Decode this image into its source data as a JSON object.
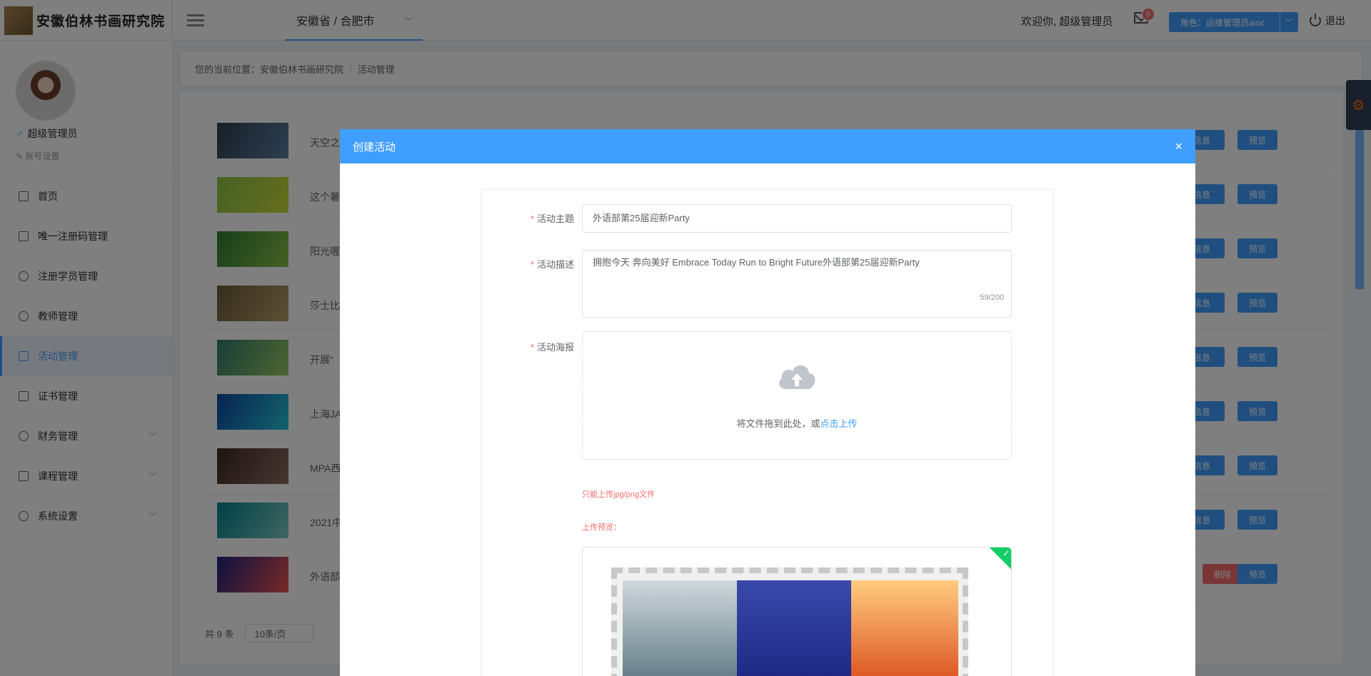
{
  "header": {
    "logo_text": "安徽伯林书画研究院",
    "region": "安徽省 / 合肥市",
    "welcome": "欢迎你, 超级管理员",
    "mail_count": "0",
    "role_label": "角色：运维管理员aioc",
    "logout": "退出"
  },
  "sidebar": {
    "user_name": "超级管理员",
    "account_settings": "账号设置",
    "items": [
      {
        "label": "首页"
      },
      {
        "label": "唯一注册码管理"
      },
      {
        "label": "注册学员管理"
      },
      {
        "label": "教师管理"
      },
      {
        "label": "活动管理"
      },
      {
        "label": "证书管理"
      },
      {
        "label": "财务管理"
      },
      {
        "label": "课程管理"
      },
      {
        "label": "系统设置"
      }
    ]
  },
  "breadcrumb": {
    "prefix": "您的当前位置：",
    "root": "安徽伯林书画研究院",
    "current": "活动管理"
  },
  "table": {
    "rows": [
      {
        "title": "天空之",
        "info": "名信息",
        "preview": "预览"
      },
      {
        "title": "这个暑",
        "info": "名信息",
        "preview": "预览"
      },
      {
        "title": "阳光喔",
        "info": "名信息",
        "preview": "预览"
      },
      {
        "title": "莎士比",
        "info": "名信息",
        "preview": "预览"
      },
      {
        "title": "开展“",
        "info": "名信息",
        "preview": "预览"
      },
      {
        "title": "上海JA",
        "info": "名信息",
        "preview": "预览"
      },
      {
        "title": "MPA西",
        "info": "名信息",
        "preview": "预览"
      },
      {
        "title": "2021中",
        "info": "名信息",
        "preview": "预览"
      },
      {
        "title": "外语部",
        "delete": "删除",
        "preview": "预览"
      }
    ],
    "total": "共 9 条",
    "page_size": "10条/页"
  },
  "dialog": {
    "title": "创建活动",
    "close": "×",
    "fields": {
      "topic_label": "活动主题",
      "topic_value": "外语部第25届迎新Party",
      "desc_label": "活动描述",
      "desc_value": "拥抱今天 奔向美好 Embrace Today  Run to Bright Future外语部第25届迎新Party",
      "desc_count": "59/200",
      "poster_label": "活动海报",
      "upload_text": "将文件拖到此处，或",
      "upload_link": "点击上传",
      "tip_type": "只能上传jpg/png文件",
      "tip_preview": "上传预览："
    }
  }
}
